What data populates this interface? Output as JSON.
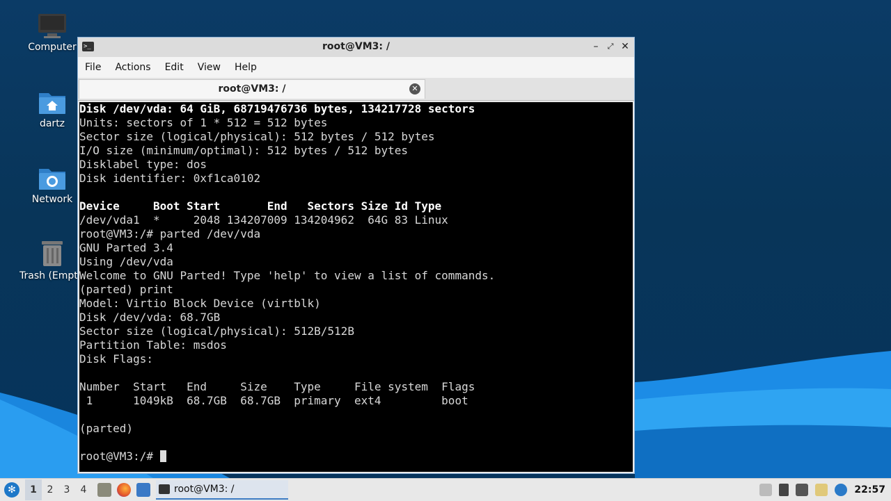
{
  "desktop_icons": [
    {
      "label": "Computer",
      "icon": "monitor-icon"
    },
    {
      "label": "dartz",
      "icon": "home-folder-icon"
    },
    {
      "label": "Network",
      "icon": "network-folder-icon"
    },
    {
      "label": "Trash (Empty)",
      "icon": "trash-icon"
    }
  ],
  "window": {
    "title": "root@VM3: /",
    "menu": [
      "File",
      "Actions",
      "Edit",
      "View",
      "Help"
    ],
    "tab_label": "root@VM3: /",
    "terminal_lines": [
      {
        "text": "Disk /dev/vda: 64 GiB, 68719476736 bytes, 134217728 sectors",
        "bold": true
      },
      {
        "text": "Units: sectors of 1 * 512 = 512 bytes",
        "bold": false
      },
      {
        "text": "Sector size (logical/physical): 512 bytes / 512 bytes",
        "bold": false
      },
      {
        "text": "I/O size (minimum/optimal): 512 bytes / 512 bytes",
        "bold": false
      },
      {
        "text": "Disklabel type: dos",
        "bold": false
      },
      {
        "text": "Disk identifier: 0xf1ca0102",
        "bold": false
      },
      {
        "text": "",
        "bold": false
      },
      {
        "text": "Device     Boot Start       End   Sectors Size Id Type",
        "bold": true
      },
      {
        "text": "/dev/vda1  *     2048 134207009 134204962  64G 83 Linux",
        "bold": false
      },
      {
        "text": "root@VM3:/# parted /dev/vda",
        "bold": false
      },
      {
        "text": "GNU Parted 3.4",
        "bold": false
      },
      {
        "text": "Using /dev/vda",
        "bold": false
      },
      {
        "text": "Welcome to GNU Parted! Type 'help' to view a list of commands.",
        "bold": false
      },
      {
        "text": "(parted) print",
        "bold": false
      },
      {
        "text": "Model: Virtio Block Device (virtblk)",
        "bold": false
      },
      {
        "text": "Disk /dev/vda: 68.7GB",
        "bold": false
      },
      {
        "text": "Sector size (logical/physical): 512B/512B",
        "bold": false
      },
      {
        "text": "Partition Table: msdos",
        "bold": false
      },
      {
        "text": "Disk Flags:",
        "bold": false
      },
      {
        "text": "",
        "bold": false
      },
      {
        "text": "Number  Start   End     Size    Type     File system  Flags",
        "bold": false
      },
      {
        "text": " 1      1049kB  68.7GB  68.7GB  primary  ext4         boot",
        "bold": false
      },
      {
        "text": "",
        "bold": false
      },
      {
        "text": "(parted)",
        "bold": false
      },
      {
        "text": "",
        "bold": false
      }
    ],
    "prompt": "root@VM3:/# "
  },
  "taskbar": {
    "workspaces": [
      "1",
      "2",
      "3",
      "4"
    ],
    "active_workspace": "1",
    "task_label": "root@VM3: /",
    "clock": "22:57"
  },
  "colors": {
    "desktop": "#0b3b66",
    "wave": "#1e90e8",
    "terminal_bg": "#000000",
    "terminal_fg": "#d8d8d8"
  }
}
